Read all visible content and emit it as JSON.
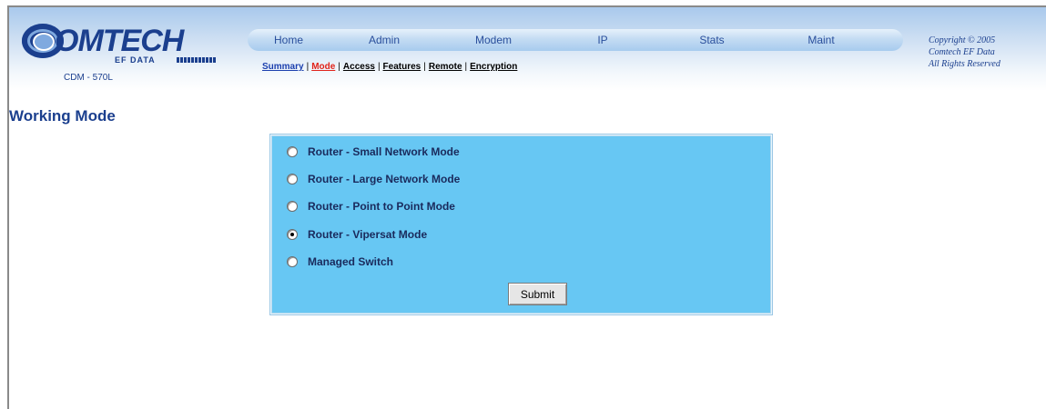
{
  "header": {
    "logo_text": "OMTECH",
    "logo_sub": "EF DATA",
    "model": "CDM - 570L",
    "copyright_lines": [
      "Copyright © 2005",
      "Comtech EF Data",
      "All Rights Reserved"
    ]
  },
  "nav": {
    "items": [
      {
        "label": "Home"
      },
      {
        "label": "Admin"
      },
      {
        "label": "Modem"
      },
      {
        "label": "IP"
      },
      {
        "label": "Stats"
      },
      {
        "label": "Maint"
      }
    ]
  },
  "subnav": {
    "items": [
      {
        "label": "Summary",
        "state": "link"
      },
      {
        "label": "Mode",
        "state": "active"
      },
      {
        "label": "Access",
        "state": "normal"
      },
      {
        "label": "Features",
        "state": "normal"
      },
      {
        "label": "Remote",
        "state": "normal"
      },
      {
        "label": "Encryption",
        "state": "normal"
      }
    ],
    "separator": "|"
  },
  "page": {
    "title": "Working Mode"
  },
  "mode_form": {
    "options": [
      {
        "label": "Router - Small Network Mode",
        "checked": false
      },
      {
        "label": "Router - Large Network Mode",
        "checked": false
      },
      {
        "label": "Router - Point to Point Mode",
        "checked": false
      },
      {
        "label": "Router - Vipersat Mode",
        "checked": true
      },
      {
        "label": "Managed Switch",
        "checked": false
      }
    ],
    "submit_label": "Submit"
  },
  "colors": {
    "brand_blue": "#1b3f8e",
    "panel_bg": "#67c7f3",
    "active_link": "#e0231a"
  }
}
